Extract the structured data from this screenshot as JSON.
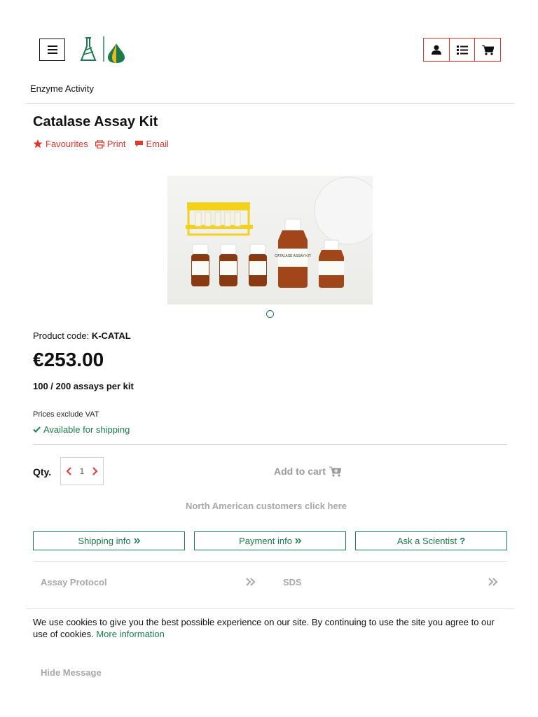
{
  "header": {
    "menu_icon": "hamburger-menu-icon",
    "logo_icon": "megazyme-flask-leaf-logo",
    "account_icon": "user-icon",
    "list_icon": "list-icon",
    "cart_icon": "shopping-cart-icon"
  },
  "breadcrumb": "Enzyme Activity",
  "product": {
    "title": "Catalase Assay Kit",
    "actions": {
      "favourites": "Favourites",
      "print": "Print",
      "email": "Email"
    },
    "image_label": "CATALASE ASSAY KIT",
    "code_label": "Product code: ",
    "code": "K-CATAL",
    "price": "€253.00",
    "assays": "100 / 200 assays per kit",
    "vat": "Prices exclude VAT",
    "availability": "Available for shipping"
  },
  "purchase": {
    "qty_label": "Qty.",
    "qty_value": "1",
    "add_to_cart": "Add to cart",
    "na_link": "North American customers click here"
  },
  "info_buttons": {
    "shipping": "Shipping info",
    "payment": "Payment info",
    "ask": "Ask a Scientist",
    "ask_mark": "?"
  },
  "documents": {
    "protocol": "Assay Protocol",
    "sds": "SDS"
  },
  "cookie": {
    "text": "We use cookies to give you the best possible experience on our site. By continuing to use the site you agree to our use of cookies.",
    "link": "More information",
    "hide": "Hide Message"
  },
  "colors": {
    "accent_red": "#e03a2e",
    "brand_green": "#1a7a4b",
    "muted_gray": "#a8a8a8"
  }
}
